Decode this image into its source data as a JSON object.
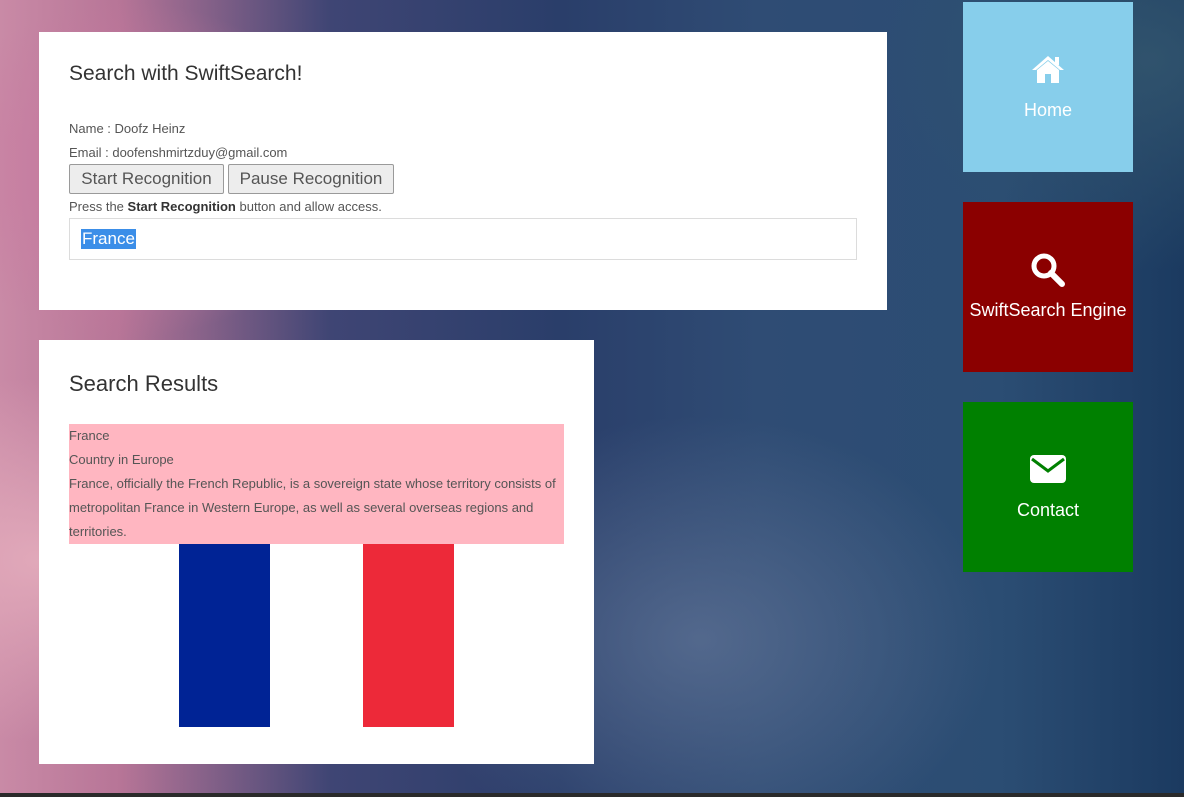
{
  "search_panel": {
    "title": "Search with SwiftSearch!",
    "name_line": "Name : Doofz Heinz",
    "email_line": "Email : doofenshmirtzduy@gmail.com",
    "start_button": "Start Recognition",
    "pause_button": "Pause Recognition",
    "hint_prefix": "Press the ",
    "hint_bold": "Start Recognition",
    "hint_suffix": " button and allow access.",
    "query": "France"
  },
  "results_panel": {
    "title": "Search Results",
    "result_title": "France",
    "result_subtitle": "Country in Europe",
    "result_description": "France, officially the French Republic, is a sovereign state whose territory consists of metropolitan France in Western Europe, as well as several overseas regions and territories.",
    "highlight_color": "#ffb6c1",
    "flag_colors": [
      "#002395",
      "#ffffff",
      "#ed2939"
    ]
  },
  "nav_tiles": [
    {
      "label": "Home",
      "icon": "home-icon",
      "color": "#87ceeb"
    },
    {
      "label": "SwiftSearch Engine",
      "icon": "search-icon",
      "color": "#8b0000"
    },
    {
      "label": "Contact",
      "icon": "envelope-icon",
      "color": "#008000"
    }
  ]
}
